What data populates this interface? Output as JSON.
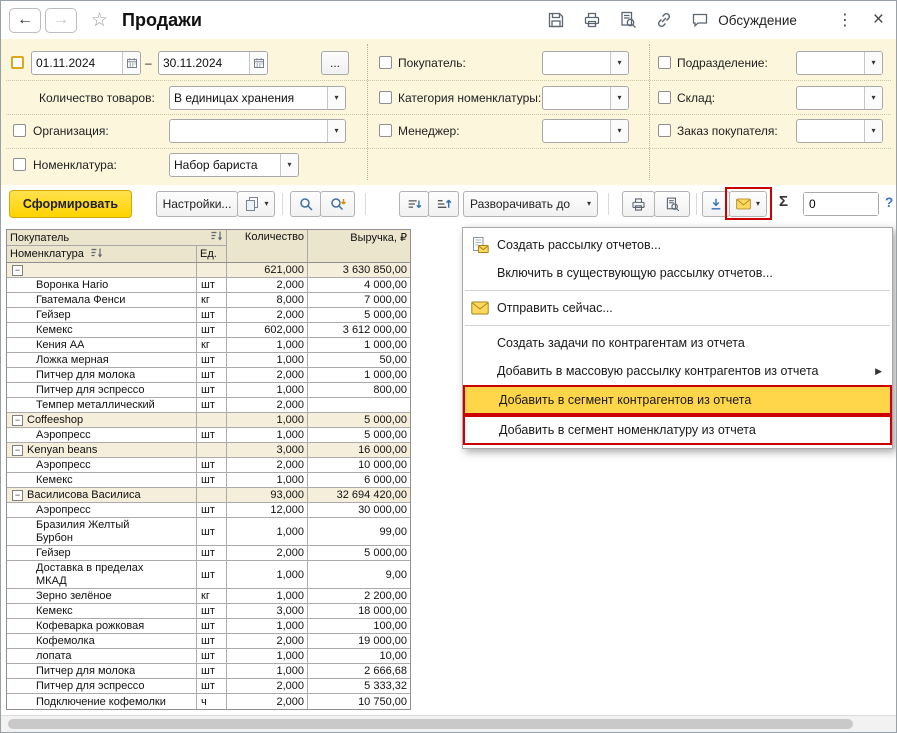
{
  "window": {
    "title": "Продажи",
    "discussion": "Обсуждение",
    "back": "←",
    "forward": "→",
    "star": "☆",
    "more": "⋮",
    "close": "×"
  },
  "filters": {
    "date_from": "01.11.2024",
    "date_dash": "–",
    "date_to": "30.11.2024",
    "dots_button": "...",
    "qty_label": "Количество товаров:",
    "qty_value": "В единицах хранения",
    "org_label": "Организация:",
    "nom_label": "Номенклатура:",
    "nom_value": "Набор бариста",
    "buyer_label": "Покупатель:",
    "category_label": "Категория номенклатуры:",
    "manager_label": "Менеджер:",
    "department_label": "Подразделение:",
    "warehouse_label": "Склад:",
    "order_label": "Заказ покупателя:"
  },
  "toolbar": {
    "generate": "Сформировать",
    "settings": "Настройки...",
    "expand_to": "Разворачивать до",
    "sigma": "Σ",
    "counter_value": "0",
    "help": "?"
  },
  "table": {
    "header": {
      "buyer": "Покупатель",
      "nomenclature": "Номенклатура",
      "unit": "Ед.",
      "quantity": "Количество",
      "revenue": "Выручка, ₽"
    },
    "rows": [
      {
        "type": "group",
        "name": "",
        "unit": "",
        "qty": "621,000",
        "rev": "3 630 850,00"
      },
      {
        "type": "item",
        "name": "Воронка Hario",
        "unit": "шт",
        "qty": "2,000",
        "rev": "4 000,00"
      },
      {
        "type": "item",
        "name": "Гватемала Фенси",
        "unit": "кг",
        "qty": "8,000",
        "rev": "7 000,00"
      },
      {
        "type": "item",
        "name": "Гейзер",
        "unit": "шт",
        "qty": "2,000",
        "rev": "5 000,00"
      },
      {
        "type": "item",
        "name": "Кемекс",
        "unit": "шт",
        "qty": "602,000",
        "rev": "3 612 000,00"
      },
      {
        "type": "item",
        "name": "Кения АА",
        "unit": "кг",
        "qty": "1,000",
        "rev": "1 000,00"
      },
      {
        "type": "item",
        "name": "Ложка мерная",
        "unit": "шт",
        "qty": "1,000",
        "rev": "50,00"
      },
      {
        "type": "item",
        "name": "Питчер для молока",
        "unit": "шт",
        "qty": "2,000",
        "rev": "1 000,00"
      },
      {
        "type": "item",
        "name": "Питчер для эспрессо",
        "unit": "шт",
        "qty": "1,000",
        "rev": "800,00"
      },
      {
        "type": "item",
        "name": "Темпер металлический",
        "unit": "шт",
        "qty": "2,000",
        "rev": ""
      },
      {
        "type": "group",
        "name": "Coffeeshop",
        "unit": "",
        "qty": "1,000",
        "rev": "5 000,00"
      },
      {
        "type": "item",
        "name": "Аэропресс",
        "unit": "шт",
        "qty": "1,000",
        "rev": "5 000,00"
      },
      {
        "type": "group",
        "name": "Kenyan beans",
        "unit": "",
        "qty": "3,000",
        "rev": "16 000,00"
      },
      {
        "type": "item",
        "name": "Аэропресс",
        "unit": "шт",
        "qty": "2,000",
        "rev": "10 000,00"
      },
      {
        "type": "item",
        "name": "Кемекс",
        "unit": "шт",
        "qty": "1,000",
        "rev": "6 000,00"
      },
      {
        "type": "group",
        "name": "Василисова Василиса",
        "unit": "",
        "qty": "93,000",
        "rev": "32 694 420,00"
      },
      {
        "type": "item",
        "name": "Аэропресс",
        "unit": "шт",
        "qty": "12,000",
        "rev": "30 000,00"
      },
      {
        "type": "item",
        "name": "Бразилия Желтый Бурбон",
        "unit": "шт",
        "qty": "1,000",
        "rev": "99,00",
        "tall": true
      },
      {
        "type": "item",
        "name": "Гейзер",
        "unit": "шт",
        "qty": "2,000",
        "rev": "5 000,00"
      },
      {
        "type": "item",
        "name": "Доставка в пределах МКАД",
        "unit": "шт",
        "qty": "1,000",
        "rev": "9,00",
        "tall": true
      },
      {
        "type": "item",
        "name": "Зерно зелёное",
        "unit": "кг",
        "qty": "1,000",
        "rev": "2 200,00"
      },
      {
        "type": "item",
        "name": "Кемекс",
        "unit": "шт",
        "qty": "3,000",
        "rev": "18 000,00"
      },
      {
        "type": "item",
        "name": "Кофеварка рожковая",
        "unit": "шт",
        "qty": "1,000",
        "rev": "100,00"
      },
      {
        "type": "item",
        "name": "Кофемолка",
        "unit": "шт",
        "qty": "2,000",
        "rev": "19 000,00"
      },
      {
        "type": "item",
        "name": "лопата",
        "unit": "шт",
        "qty": "1,000",
        "rev": "10,00"
      },
      {
        "type": "item",
        "name": "Питчер для молока",
        "unit": "шт",
        "qty": "1,000",
        "rev": "2 666,68"
      },
      {
        "type": "item",
        "name": "Питчер для эспрессо",
        "unit": "шт",
        "qty": "2,000",
        "rev": "5 333,32"
      },
      {
        "type": "item",
        "name": "Подключение кофемолки",
        "unit": "ч",
        "qty": "2,000",
        "rev": "10 750,00"
      }
    ]
  },
  "menu": {
    "items": [
      {
        "label": "Создать рассылку отчетов...",
        "icon": "create-mailing-icon"
      },
      {
        "label": "Включить в существующую рассылку отчетов..."
      },
      {
        "separator": true
      },
      {
        "label": "Отправить сейчас...",
        "icon": "send-now-envelope-icon"
      },
      {
        "separator": true
      },
      {
        "label": "Создать задачи по контрагентам из отчета"
      },
      {
        "label": "Добавить в массовую рассылку контрагентов из отчета",
        "submenu": true
      },
      {
        "label": "Добавить в сегмент контрагентов из отчета",
        "highlighted": true,
        "annotated": true
      },
      {
        "label": "Добавить в сегмент номенклатуру из отчета",
        "annotated": true
      }
    ]
  },
  "colors": {
    "panel_yellow": "#fcf6dd",
    "accent_yellow": "#ffd400",
    "highlight_yellow": "#ffd54a",
    "annotation_red": "#cc0000",
    "group_row": "#f4eedb",
    "header_row": "#ece5cd"
  }
}
